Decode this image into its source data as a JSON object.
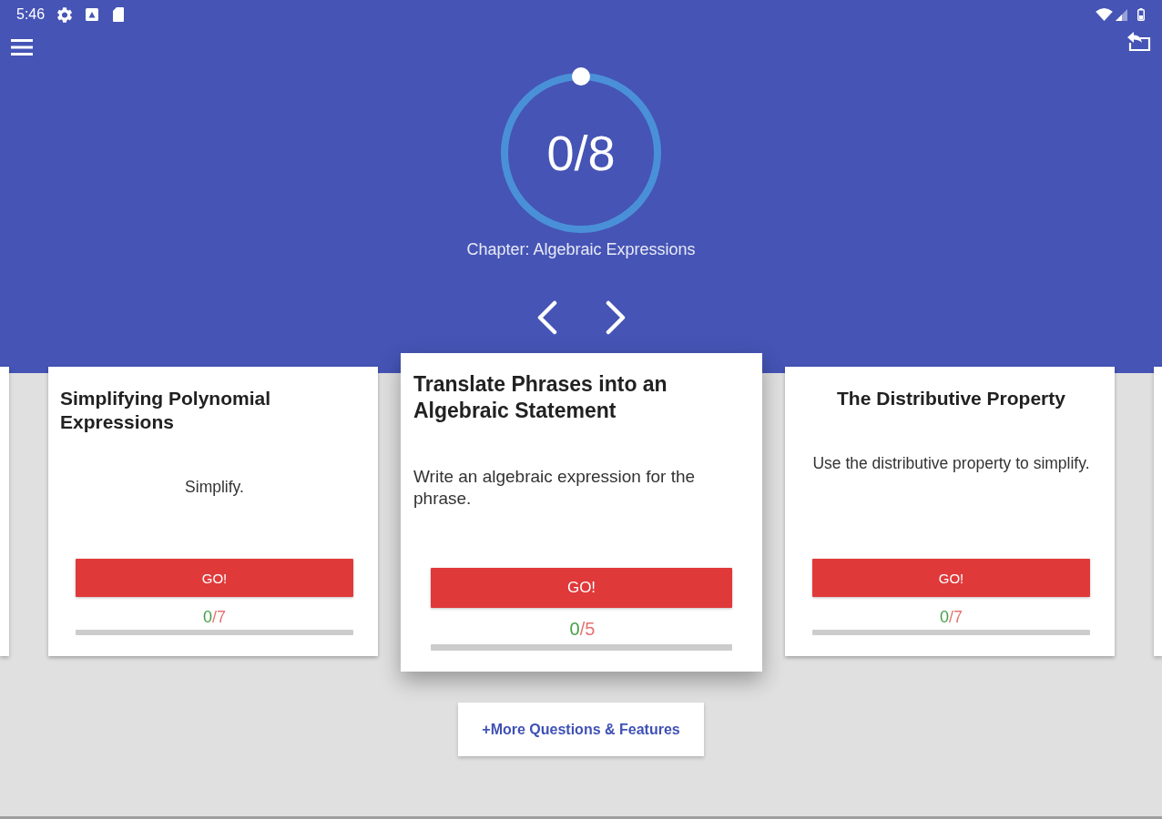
{
  "status_bar": {
    "time": "5:46"
  },
  "progress": {
    "reading": "0/8"
  },
  "chapter": "Chapter: Algebraic Expressions",
  "cards": [
    {
      "title": "Simplifying Polynomial Expressions",
      "description": "Simplify.",
      "button": "GO!",
      "correct": "0",
      "total": "/7",
      "level": 0,
      "selected": false
    },
    {
      "title": "Translate Phrases into an Algebraic Statement",
      "description": "Write an algebraic expression for the phrase.",
      "button": "GO!",
      "correct": "0",
      "total": "/5",
      "level": 0,
      "selected": true
    },
    {
      "title": "The Distributive Property",
      "description": "Use the distributive property to simplify.",
      "button": "GO!",
      "correct": "0",
      "total": "/7",
      "level": 0,
      "selected": false
    }
  ],
  "more_button": "+More Questions & Features"
}
